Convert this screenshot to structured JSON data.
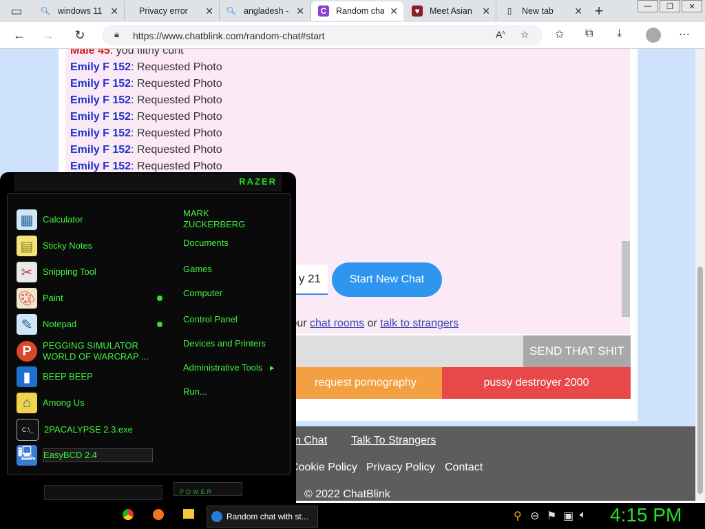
{
  "browser": {
    "tabs": [
      {
        "icon": "search-icon",
        "label": "windows 11"
      },
      {
        "icon": "page-icon",
        "label": "Privacy error"
      },
      {
        "icon": "search-icon",
        "label": "angladesh -"
      },
      {
        "icon": "c-logo-icon",
        "label": "Random cha"
      },
      {
        "icon": "site-logo-icon",
        "label": "Meet Asian"
      },
      {
        "icon": "page-icon",
        "label": "New tab"
      }
    ],
    "new_tab": "+",
    "url": "https://www.chatblink.com/random-chat#start"
  },
  "chat": {
    "messages": [
      {
        "nick": "Male 45",
        "text": ": you filthy cunt",
        "gender": "male"
      },
      {
        "nick": "Emily F 152",
        "text": ": Requested Photo",
        "gender": "female"
      },
      {
        "nick": "Emily F 152",
        "text": ": Requested Photo",
        "gender": "female"
      },
      {
        "nick": "Emily F 152",
        "text": ": Requested Photo",
        "gender": "female"
      },
      {
        "nick": "Emily F 152",
        "text": ": Requested Photo",
        "gender": "female"
      },
      {
        "nick": "Emily F 152",
        "text": ": Requested Photo",
        "gender": "female"
      },
      {
        "nick": "Emily F 152",
        "text": ": Requested Photo",
        "gender": "female"
      },
      {
        "nick": "Emily F 152",
        "text": ": Requested Photo",
        "gender": "female"
      }
    ],
    "age_value": "y 21",
    "start_button": "Start New Chat",
    "try_prefix": "y our ",
    "chat_rooms_link": "chat rooms",
    "or_text": " or ",
    "talk_link": "talk to strangers",
    "send_button": "SEND THAT SHIT",
    "request_button": "request pornography",
    "destroyer_button": "pussy destroyer 2000"
  },
  "footer": {
    "chat_link": "n Chat",
    "talk_link": "Talk To Strangers",
    "cookie": "Cookie Policy",
    "privacy": "Privacy Policy",
    "contact": "Contact",
    "copyright": "© 2022 ChatBlink"
  },
  "startmenu": {
    "brand": "RAZER",
    "apps": [
      {
        "icon": "calculator-icon",
        "label": "Calculator"
      },
      {
        "icon": "sticky-notes-icon",
        "label": "Sticky Notes"
      },
      {
        "icon": "snipping-tool-icon",
        "label": "Snipping Tool"
      },
      {
        "icon": "paint-icon",
        "label": "Paint"
      },
      {
        "icon": "notepad-icon",
        "label": "Notepad"
      },
      {
        "icon": "pegging-icon",
        "label": "PEGGING SIMULATOR\nWORLD OF WARCRAP ..."
      },
      {
        "icon": "phone-icon",
        "label": "BEEP BEEP"
      },
      {
        "icon": "among-us-icon",
        "label": "Among Us"
      },
      {
        "icon": "cmd-icon",
        "label": "2PACALYPSE 2.3.exe"
      },
      {
        "icon": "computer-icon",
        "label": "EasyBCD 2.4"
      }
    ],
    "right": [
      "MARK ZUCKERBERG",
      "Documents",
      "Games",
      "Computer",
      "Control Panel",
      "Devices and Printers",
      "Administrative Tools",
      "Run..."
    ],
    "admin_arrow": "▸",
    "power": "POWER"
  },
  "taskbar": {
    "task_label": "Random chat with st...",
    "clock": "4:15 PM"
  },
  "colors": {
    "accent": "#2f96f0",
    "green": "#3ff23f",
    "nick_female": "#1a33cc",
    "nick_male": "#cc1f1f"
  }
}
